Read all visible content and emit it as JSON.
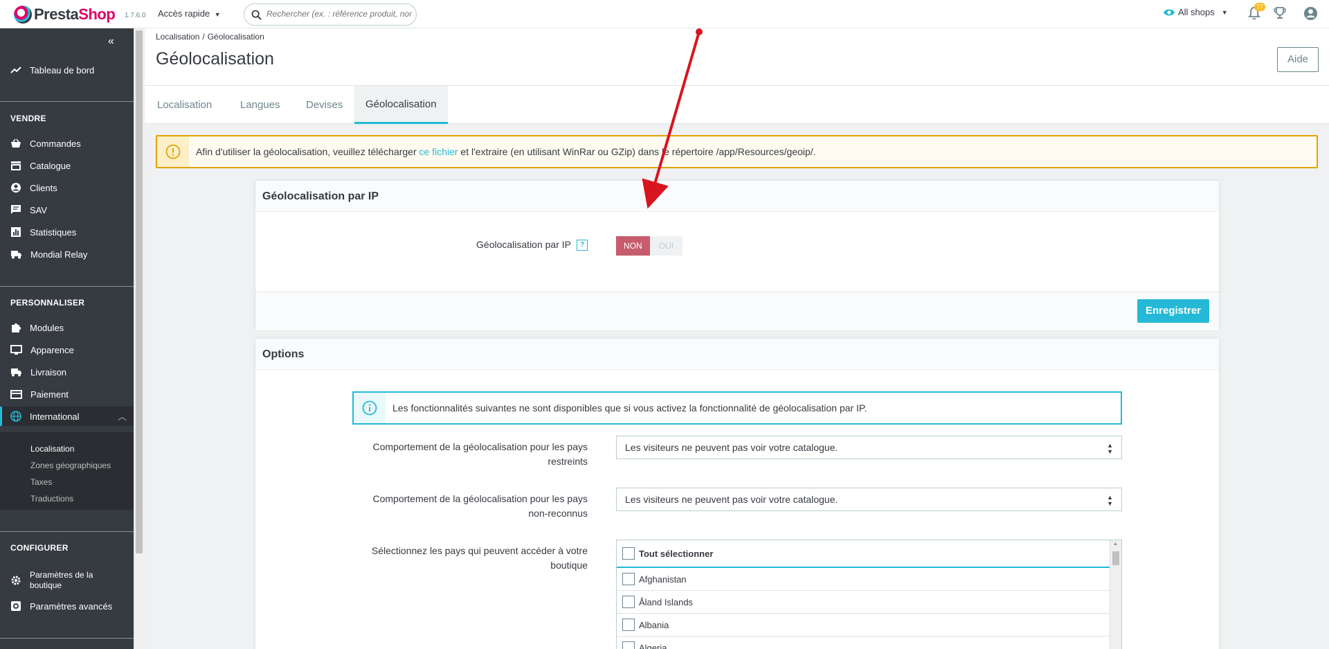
{
  "header": {
    "logo_pre": "Presta",
    "logo_post": "Shop",
    "version": "1.7.6.0",
    "quick_access": "Accès rapide",
    "search_placeholder": "Rechercher (ex. : référence produit, nom",
    "shop_selector": "All shops",
    "notifications_count": "77"
  },
  "sidebar": {
    "dashboard": "Tableau de bord",
    "sections": {
      "sell": "VENDRE",
      "customize": "PERSONNALISER",
      "configure": "CONFIGURER"
    },
    "sell_items": [
      "Commandes",
      "Catalogue",
      "Clients",
      "SAV",
      "Statistiques",
      "Mondial Relay"
    ],
    "customize_items": [
      "Modules",
      "Apparence",
      "Livraison",
      "Paiement",
      "International"
    ],
    "international_sub": [
      "Localisation",
      "Zones géographiques",
      "Taxes",
      "Traductions"
    ],
    "configure_items": [
      "Paramètres de la boutique",
      "Paramètres avancés"
    ]
  },
  "page": {
    "breadcrumb": [
      "Localisation",
      "Géolocalisation"
    ],
    "title": "Géolocalisation",
    "help_button": "Aide",
    "tabs": [
      "Localisation",
      "Langues",
      "Devises",
      "Géolocalisation"
    ],
    "active_tab": "Géolocalisation"
  },
  "warning": {
    "text_before": "Afin d'utiliser la géolocalisation, veuillez télécharger ",
    "link": "ce fichier",
    "text_after": " et l'extraire (en utilisant WinRar ou GZip) dans le répertoire /app/Resources/geoip/."
  },
  "panel_ip": {
    "title": "Géolocalisation par IP",
    "field_label": "Géolocalisation par IP",
    "help_icon": "?",
    "switch_no": "NON",
    "switch_yes": "OUI",
    "switch_value": "NON",
    "save": "Enregistrer"
  },
  "panel_options": {
    "title": "Options",
    "info": "Les fonctionnalités suivantes ne sont disponibles que si vous activez la fonctionnalité de géolocalisation par IP.",
    "restricted_label_1": "Comportement de la géolocalisation pour les pays",
    "restricted_label_2": "restreints",
    "restricted_value": "Les visiteurs ne peuvent pas voir votre catalogue.",
    "unknown_label_1": "Comportement de la géolocalisation pour les pays",
    "unknown_label_2": "non-reconnus",
    "unknown_value": "Les visiteurs ne peuvent pas voir votre catalogue.",
    "countries_label_1": "Sélectionnez les pays qui peuvent accéder à votre",
    "countries_label_2": "boutique",
    "select_all": "Tout sélectionner",
    "countries": [
      "Afghanistan",
      "Åland Islands",
      "Albania",
      "Algeria"
    ]
  },
  "colors": {
    "accent": "#25b9d7",
    "brand": "#df0067",
    "sidebar": "#363a41",
    "warning": "#e5a100",
    "switch_no": "#c75d6c",
    "arrow": "#d8141e"
  }
}
